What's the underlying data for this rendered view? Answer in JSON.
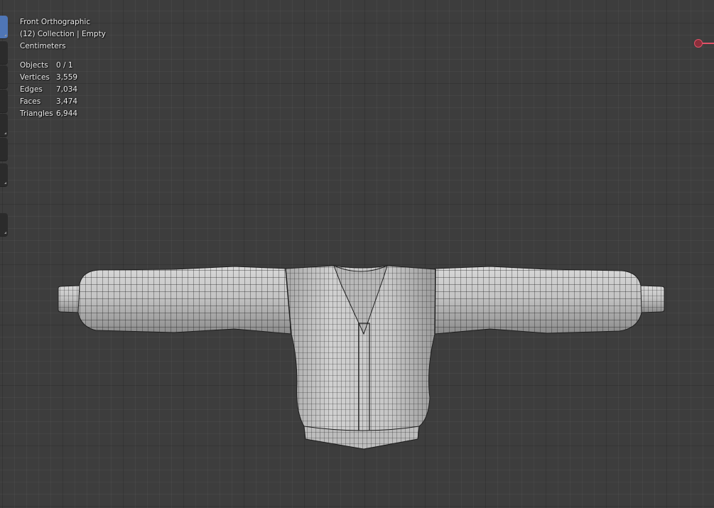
{
  "viewport": {
    "view_name": "Front Orthographic",
    "collection": "(12) Collection | Empty",
    "units": "Centimeters"
  },
  "stats": [
    {
      "label": "Objects",
      "value": "0 / 1"
    },
    {
      "label": "Vertices",
      "value": "3,559"
    },
    {
      "label": "Edges",
      "value": "7,034"
    },
    {
      "label": "Faces",
      "value": "3,474"
    },
    {
      "label": "Triangles",
      "value": "6,944"
    }
  ],
  "toolbar": {
    "tools": [
      "select-tool",
      "cursor-tool",
      "move-tool",
      "rotate-tool",
      "scale-tool",
      "transform-tool",
      "annotate-tool",
      "measure-tool"
    ],
    "active_tool": "select-tool"
  },
  "colors": {
    "background": "#3d3d3d",
    "mesh_fill": "#c8c8c8",
    "wire": "#1e1e1e",
    "active_tool": "#4f76b6",
    "gizmo_x": "#e35167"
  }
}
